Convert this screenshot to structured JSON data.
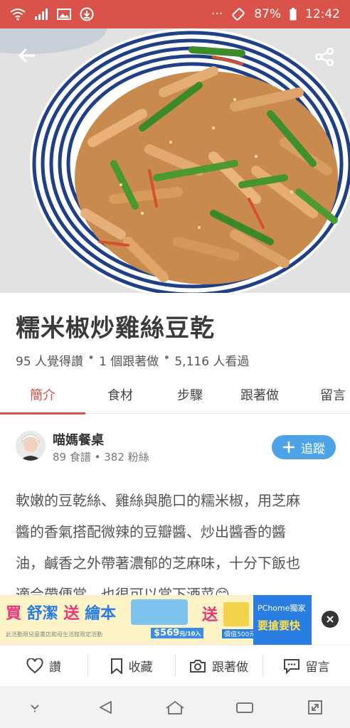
{
  "status_bar": {
    "icons_left": [
      "wifi-icon",
      "signal-icon",
      "gallery-icon",
      "download-icon"
    ],
    "more": "···",
    "battery": "87%",
    "time": "12:42"
  },
  "recipe": {
    "title": "糯米椒炒雞絲豆乾",
    "stats": {
      "likes": "95 人覺得讚",
      "followers_made": "1 個跟著做",
      "views": "5,116 人看過",
      "separator": "•"
    }
  },
  "tabs": [
    {
      "label": "簡介",
      "active": true
    },
    {
      "label": "食材",
      "active": false
    },
    {
      "label": "步驟",
      "active": false
    },
    {
      "label": "跟著做",
      "active": false
    },
    {
      "label": "留言",
      "active": false
    }
  ],
  "author": {
    "name": "喵媽餐桌",
    "meta": "89 食譜 • 382 粉絲",
    "follow_label": "追蹤"
  },
  "description": [
    "軟嫩的豆乾絲、雞絲與脆口的糯米椒，用芝麻",
    "醬的香氣搭配微辣的豆瓣醬、炒出醬香的醬",
    "油，鹹香之外帶著濃郁的芝麻味，十分下飯也",
    "適合帶便當，也很可以當下酒菜😊"
  ],
  "ad": {
    "text_1": "買",
    "text_2": "舒潔",
    "text_3": "送",
    "text_4": "繪本",
    "fine_print": "此活動限兒童書店和母生活館限定活動",
    "price": "$569",
    "price_unit": "元/10入",
    "gift": "送",
    "gift_value": "價值500元",
    "brand": "PChome獨家",
    "brand_cta": "要搶要快",
    "colors": {
      "yellow": "#fdf3c6",
      "pink": "#e8357a",
      "blue": "#2a7de1"
    }
  },
  "actions": [
    {
      "label": "讚",
      "icon": "heart-icon"
    },
    {
      "label": "收藏",
      "icon": "bookmark-icon"
    },
    {
      "label": "跟著做",
      "icon": "camera-icon"
    },
    {
      "label": "留言",
      "icon": "comment-icon"
    }
  ],
  "navbar": [
    "chevron-down-icon",
    "back-triangle-icon",
    "home-icon",
    "recent-apps-icon",
    "expand-icon"
  ],
  "colors": {
    "accent": "#d9534a",
    "follow": "#4da3e6"
  }
}
